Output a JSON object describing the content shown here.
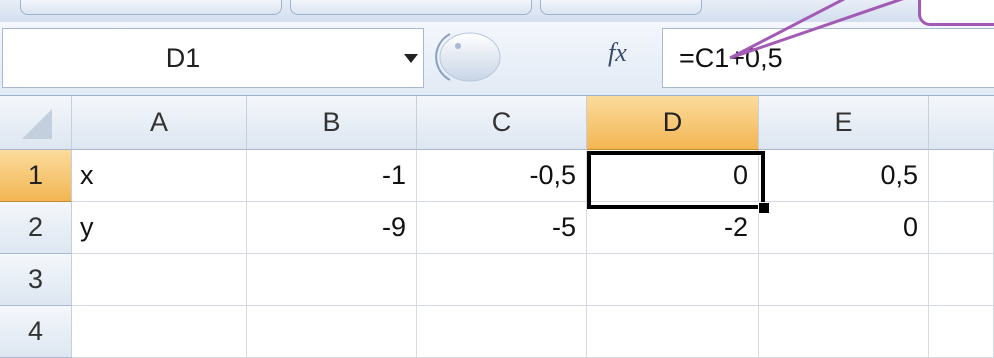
{
  "formula_bar": {
    "name_box": "D1",
    "fx_icon": "fx",
    "formula": "=C1+0,5"
  },
  "grid": {
    "columns": [
      "A",
      "B",
      "C",
      "D",
      "E"
    ],
    "selected_column": "D",
    "selected_row": "1",
    "rows": [
      {
        "label": "1",
        "cells": [
          "x",
          "-1",
          "-0,5",
          "0",
          "0,5"
        ]
      },
      {
        "label": "2",
        "cells": [
          "y",
          "-9",
          "-5",
          "-2",
          "0"
        ]
      },
      {
        "label": "3",
        "cells": [
          "",
          "",
          "",
          "",
          ""
        ]
      },
      {
        "label": "4",
        "cells": [
          "",
          "",
          "",
          "",
          ""
        ]
      }
    ]
  },
  "colors": {
    "header_selected": "#f3b553",
    "callout": "#a35ab4"
  },
  "icons": {
    "name_box_dropdown": "triangle-down-icon",
    "cancel": "circle-button-icon",
    "function": "fx-icon"
  }
}
